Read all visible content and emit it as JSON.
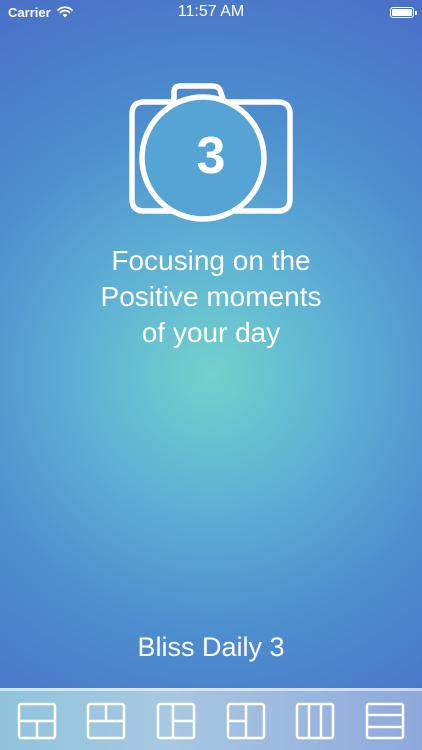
{
  "status_bar": {
    "carrier": "Carrier",
    "time": "11:57 AM",
    "battery_level": 1.0
  },
  "logo": {
    "icon": "camera-icon",
    "number": "3"
  },
  "tagline": {
    "line1": "Focusing on the",
    "line2": "Positive moments",
    "line3": "of your day"
  },
  "app_name": "Bliss Daily 3",
  "layout_options": [
    "layout-top-big-two-bottom-icon",
    "layout-two-by-two-icon",
    "layout-left-big-two-right-icon",
    "layout-two-columns-split-right-icon",
    "layout-three-columns-icon",
    "layout-three-rows-icon"
  ],
  "colors": {
    "gradient_center": "#72d2cc",
    "gradient_edge": "#4a6fc7",
    "foreground": "#ffffff"
  }
}
